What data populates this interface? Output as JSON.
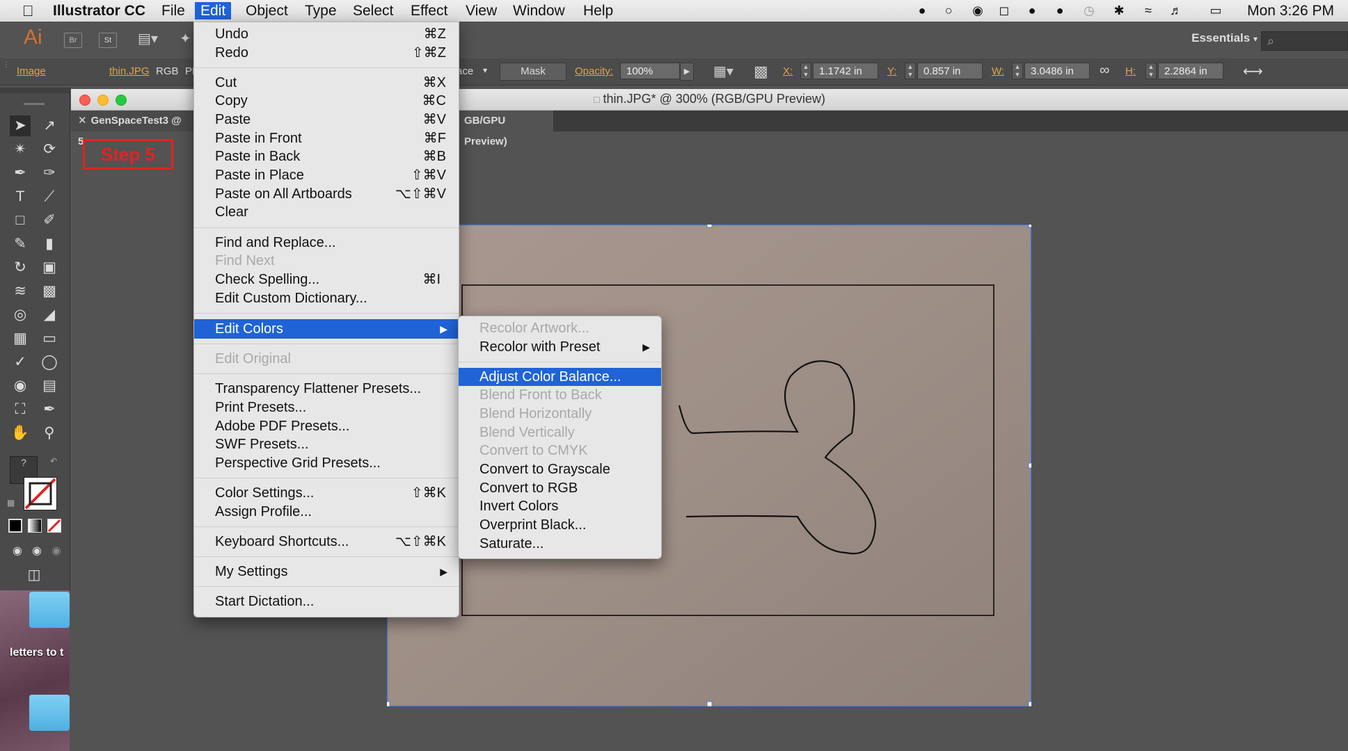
{
  "menubar": {
    "apple_icon": "apple-icon",
    "items": [
      "Illustrator CC",
      "File",
      "Edit",
      "Object",
      "Type",
      "Select",
      "Effect",
      "View",
      "Window",
      "Help"
    ],
    "clock": "Mon 3:26 PM"
  },
  "appbar": {
    "logo": "Ai",
    "br": "Br",
    "st": "St",
    "workspace": "Essentials",
    "search_icon": "⌕"
  },
  "control": {
    "image_label": "Image",
    "file_link": "thin.JPG",
    "color_mode": "RGB",
    "ppi_fragment": "PP",
    "embed_fragment": "ace",
    "mask": "Mask",
    "opacity_label": "Opacity:",
    "opacity_value": "100%",
    "x_label": "X:",
    "x_value": "1.1742 in",
    "y_label": "Y:",
    "y_value": "0.857 in",
    "w_label": "W:",
    "w_value": "3.0486 in",
    "h_label": "H:",
    "h_value": "2.2864 in"
  },
  "document": {
    "title": "thin.JPG* @ 300% (RGB/GPU Preview)",
    "tab1": "GenSpaceTest3 @ 5",
    "tab2": "GB/GPU Preview)",
    "annotation": "Step 5"
  },
  "desktop": {
    "label": "letters to t"
  },
  "edit_menu": {
    "undo": "Undo",
    "undo_sc": "⌘Z",
    "redo": "Redo",
    "redo_sc": "⇧⌘Z",
    "cut": "Cut",
    "cut_sc": "⌘X",
    "copy": "Copy",
    "copy_sc": "⌘C",
    "paste": "Paste",
    "paste_sc": "⌘V",
    "paste_front": "Paste in Front",
    "paste_front_sc": "⌘F",
    "paste_back": "Paste in Back",
    "paste_back_sc": "⌘B",
    "paste_place": "Paste in Place",
    "paste_place_sc": "⇧⌘V",
    "paste_all": "Paste on All Artboards",
    "paste_all_sc": "⌥⇧⌘V",
    "clear": "Clear",
    "find_replace": "Find and Replace...",
    "find_next": "Find Next",
    "check_spelling": "Check Spelling...",
    "check_spelling_sc": "⌘I",
    "edit_dictionary": "Edit Custom Dictionary...",
    "edit_colors": "Edit Colors",
    "edit_original": "Edit Original",
    "transparency": "Transparency Flattener Presets...",
    "print_presets": "Print Presets...",
    "pdf_presets": "Adobe PDF Presets...",
    "swf_presets": "SWF Presets...",
    "perspective": "Perspective Grid Presets...",
    "color_settings": "Color Settings...",
    "color_settings_sc": "⇧⌘K",
    "assign_profile": "Assign Profile...",
    "keyboard": "Keyboard Shortcuts...",
    "keyboard_sc": "⌥⇧⌘K",
    "my_settings": "My Settings",
    "dictation": "Start Dictation..."
  },
  "colors_menu": {
    "recolor": "Recolor Artwork...",
    "recolor_preset": "Recolor with Preset",
    "adjust": "Adjust Color Balance...",
    "blend_fb": "Blend Front to Back",
    "blend_h": "Blend Horizontally",
    "blend_v": "Blend Vertically",
    "cmyk": "Convert to CMYK",
    "grayscale": "Convert to Grayscale",
    "rgb": "Convert to RGB",
    "invert": "Invert Colors",
    "overprint": "Overprint Black...",
    "saturate": "Saturate..."
  },
  "colors": {
    "highlight": "#1f63d6",
    "annotation_red": "#e32222",
    "photo_bg": "#a3958d"
  }
}
